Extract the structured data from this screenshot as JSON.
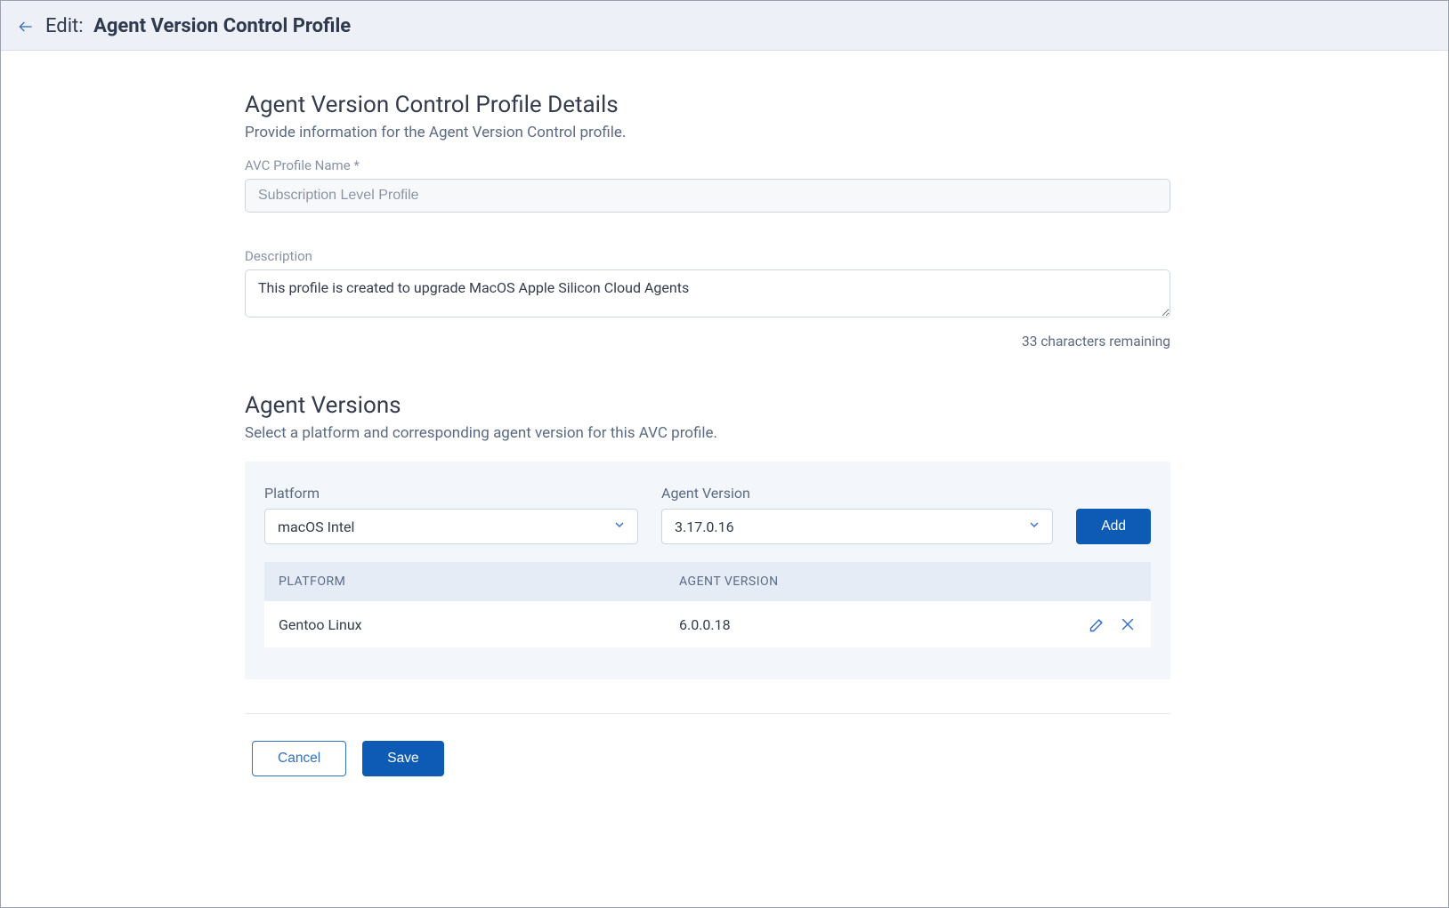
{
  "header": {
    "prefix": "Edit:",
    "title": "Agent Version Control Profile"
  },
  "details": {
    "heading": "Agent Version Control Profile Details",
    "subheading": "Provide information for the Agent Version Control profile.",
    "name_label": "AVC Profile Name *",
    "name_value": "Subscription Level Profile",
    "description_label": "Description",
    "description_value": "This profile is created to upgrade MacOS Apple Silicon Cloud Agents",
    "chars_remaining": "33 characters remaining"
  },
  "agent_versions": {
    "heading": "Agent Versions",
    "subheading": "Select a platform and corresponding agent version for this AVC profile.",
    "platform_label": "Platform",
    "platform_selected": "macOS Intel",
    "version_label": "Agent Version",
    "version_selected": "3.17.0.16",
    "add_label": "Add",
    "table": {
      "col_platform": "PLATFORM",
      "col_version": "AGENT VERSION",
      "rows": [
        {
          "platform": "Gentoo Linux",
          "version": "6.0.0.18"
        }
      ]
    }
  },
  "footer": {
    "cancel": "Cancel",
    "save": "Save"
  }
}
